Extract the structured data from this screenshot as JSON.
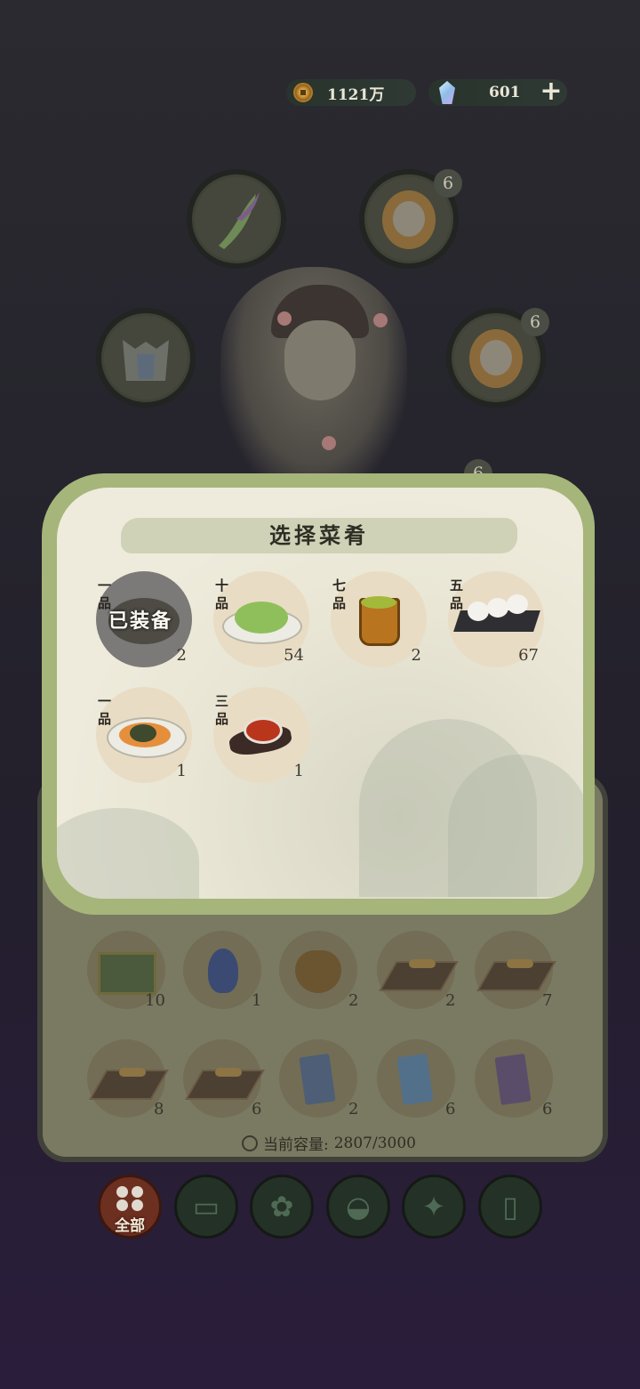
{
  "currency": {
    "coins": "1121万",
    "gems": "601",
    "plus": "+"
  },
  "equipment_badges": [
    "6",
    "6",
    "6"
  ],
  "popup": {
    "title": "选择菜肴",
    "equipped_label": "已装备",
    "dishes": [
      {
        "grade": "一品",
        "count": "2",
        "equipped": true,
        "icon": "stew-bowl-icon"
      },
      {
        "grade": "十品",
        "count": "54",
        "equipped": false,
        "icon": "vegetable-plate-icon"
      },
      {
        "grade": "七品",
        "count": "2",
        "equipped": false,
        "icon": "soup-cup-icon"
      },
      {
        "grade": "五品",
        "count": "67",
        "equipped": false,
        "icon": "rice-balls-icon"
      },
      {
        "grade": "一品",
        "count": "1",
        "equipped": false,
        "icon": "stir-fry-plate-icon"
      },
      {
        "grade": "三品",
        "count": "1",
        "equipped": false,
        "icon": "red-soup-bowl-icon"
      }
    ]
  },
  "inventory": {
    "items": [
      {
        "count": "10",
        "icon": "landscape-painting-icon"
      },
      {
        "count": "1",
        "icon": "blue-flame-icon"
      },
      {
        "count": "2",
        "icon": "cloth-bag-icon"
      },
      {
        "count": "2",
        "icon": "cutting-board-icon"
      },
      {
        "count": "7",
        "icon": "cutting-board-icon"
      },
      {
        "count": "8",
        "icon": "cutting-board-icon"
      },
      {
        "count": "6",
        "icon": "cutting-board-icon"
      },
      {
        "count": "2",
        "icon": "blue-scroll-icon"
      },
      {
        "count": "6",
        "icon": "blue-scroll-icon"
      },
      {
        "count": "6",
        "icon": "purple-scroll-icon"
      }
    ],
    "capacity_label": "当前容量:",
    "capacity_value": "2807/3000"
  },
  "tabs": [
    {
      "label": "全部",
      "icon": "all-grid-icon",
      "active": true
    },
    {
      "label": "",
      "icon": "log-icon",
      "active": false
    },
    {
      "label": "",
      "icon": "herb-icon",
      "active": false
    },
    {
      "label": "",
      "icon": "rice-bowl-icon",
      "active": false
    },
    {
      "label": "",
      "icon": "map-piece-icon",
      "active": false
    },
    {
      "label": "",
      "icon": "scroll-icon",
      "active": false
    }
  ],
  "colors": {
    "panel_green": "#a6b57a",
    "active_tab": "#6d2f1f",
    "parchment": "#eeebdc"
  }
}
